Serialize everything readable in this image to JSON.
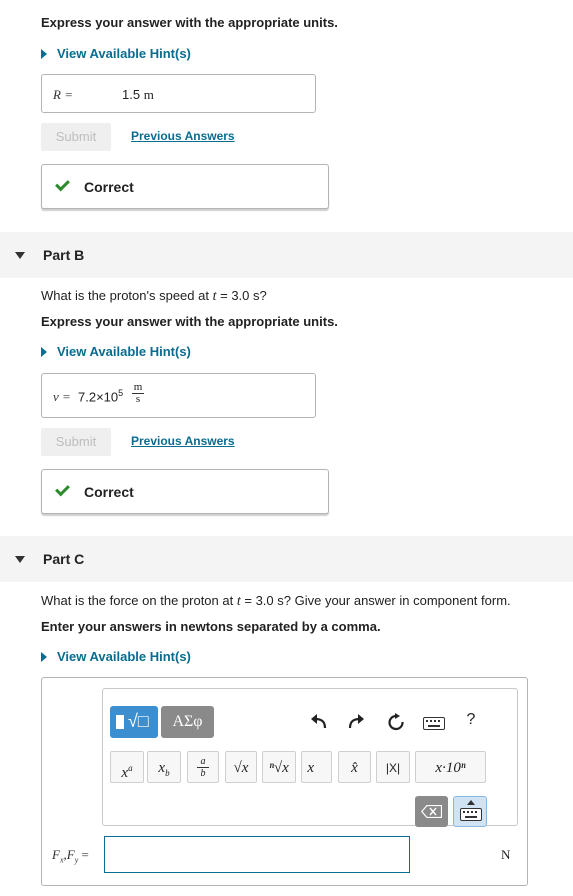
{
  "part_a": {
    "instruction": "Express your answer with the appropriate units.",
    "hint": "View Available Hint(s)",
    "answer_label": "R =",
    "answer_value": "1.5",
    "answer_unit": "m",
    "submit": "Submit",
    "previous": "Previous Answers",
    "feedback": "Correct"
  },
  "part_b": {
    "title": "Part B",
    "question_pre": "What is the proton's speed at",
    "question_var": "t",
    "question_post": "= 3.0 s?",
    "instruction": "Express your answer with the appropriate units.",
    "hint": "View Available Hint(s)",
    "answer_label": "v =",
    "answer_mantissa": "7.2×10",
    "answer_exponent": "5",
    "unit_num": "m",
    "unit_den": "s",
    "submit": "Submit",
    "previous": "Previous Answers",
    "feedback": "Correct"
  },
  "part_c": {
    "title": "Part C",
    "question_pre": "What is the force on the proton at",
    "question_var": "t",
    "question_post": "= 3.0 s? Give your answer in component form.",
    "instruction": "Enter your answers in newtons separated by a comma.",
    "hint": "View Available Hint(s)",
    "answer_label": "F_x,F_y =",
    "answer_value": "",
    "unit": "N",
    "toolbar": {
      "templates": "√□",
      "symbols": "ΑΣφ",
      "help": "?",
      "superscript": "x^a",
      "subscript": "x_b",
      "fraction": "a/b",
      "sqrt": "√x",
      "nthroot": "ⁿ√x",
      "vector": "x⃗",
      "unitvec": "x̂",
      "abs": "|X|",
      "sci": "x·10ⁿ"
    }
  }
}
